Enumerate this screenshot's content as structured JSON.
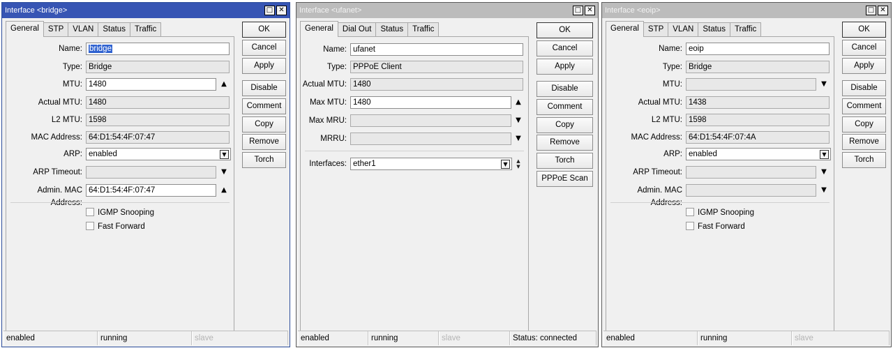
{
  "windows": [
    {
      "title": "Interface <bridge>",
      "tabs": [
        "General",
        "STP",
        "VLAN",
        "Status",
        "Traffic"
      ],
      "fields": {
        "name": {
          "label": "Name:",
          "value": "bridge"
        },
        "type": {
          "label": "Type:",
          "value": "Bridge"
        },
        "mtu": {
          "label": "MTU:",
          "value": "1480"
        },
        "actual_mtu": {
          "label": "Actual MTU:",
          "value": "1480"
        },
        "l2_mtu": {
          "label": "L2 MTU:",
          "value": "1598"
        },
        "mac": {
          "label": "MAC Address:",
          "value": "64:D1:54:4F:07:47"
        },
        "arp": {
          "label": "ARP:",
          "value": "enabled"
        },
        "arp_timeout": {
          "label": "ARP Timeout:",
          "value": ""
        },
        "admin_mac": {
          "label": "Admin. MAC Address:",
          "value": "64:D1:54:4F:07:47"
        }
      },
      "checkboxes": {
        "igmp": "IGMP Snooping",
        "fast_forward": "Fast Forward"
      },
      "buttons": {
        "ok": "OK",
        "cancel": "Cancel",
        "apply": "Apply",
        "disable": "Disable",
        "comment": "Comment",
        "copy": "Copy",
        "remove": "Remove",
        "torch": "Torch"
      },
      "status": {
        "state": "enabled",
        "run": "running",
        "slave": "slave"
      }
    },
    {
      "title": "Interface <ufanet>",
      "tabs": [
        "General",
        "Dial Out",
        "Status",
        "Traffic"
      ],
      "fields": {
        "name": {
          "label": "Name:",
          "value": "ufanet"
        },
        "type": {
          "label": "Type:",
          "value": "PPPoE Client"
        },
        "actual_mtu": {
          "label": "Actual MTU:",
          "value": "1480"
        },
        "max_mtu": {
          "label": "Max MTU:",
          "value": "1480"
        },
        "max_mru": {
          "label": "Max MRU:",
          "value": ""
        },
        "mrru": {
          "label": "MRRU:",
          "value": ""
        },
        "interfaces": {
          "label": "Interfaces:",
          "value": "ether1"
        }
      },
      "buttons": {
        "ok": "OK",
        "cancel": "Cancel",
        "apply": "Apply",
        "disable": "Disable",
        "comment": "Comment",
        "copy": "Copy",
        "remove": "Remove",
        "torch": "Torch",
        "pppoe_scan": "PPPoE Scan"
      },
      "status": {
        "state": "enabled",
        "run": "running",
        "slave": "slave",
        "connection": "Status: connected"
      }
    },
    {
      "title": "Interface <eoip>",
      "tabs": [
        "General",
        "STP",
        "VLAN",
        "Status",
        "Traffic"
      ],
      "fields": {
        "name": {
          "label": "Name:",
          "value": "eoip"
        },
        "type": {
          "label": "Type:",
          "value": "Bridge"
        },
        "mtu": {
          "label": "MTU:",
          "value": ""
        },
        "actual_mtu": {
          "label": "Actual MTU:",
          "value": "1438"
        },
        "l2_mtu": {
          "label": "L2 MTU:",
          "value": "1598"
        },
        "mac": {
          "label": "MAC Address:",
          "value": "64:D1:54:4F:07:4A"
        },
        "arp": {
          "label": "ARP:",
          "value": "enabled"
        },
        "arp_timeout": {
          "label": "ARP Timeout:",
          "value": ""
        },
        "admin_mac": {
          "label": "Admin. MAC Address:",
          "value": ""
        }
      },
      "checkboxes": {
        "igmp": "IGMP Snooping",
        "fast_forward": "Fast Forward"
      },
      "buttons": {
        "ok": "OK",
        "cancel": "Cancel",
        "apply": "Apply",
        "disable": "Disable",
        "comment": "Comment",
        "copy": "Copy",
        "remove": "Remove",
        "torch": "Torch"
      },
      "status": {
        "state": "enabled",
        "run": "running",
        "slave": "slave"
      }
    }
  ],
  "icons": {
    "restore": "restore-icon",
    "close": "close-icon",
    "dropdown": "dropdown-icon",
    "arrow_up": "arrow-up-icon",
    "arrow_down": "arrow-down-icon"
  },
  "colors": {
    "active_title": "#3755b4",
    "inactive_title": "#bcbcbc",
    "selection": "#2f62d0"
  }
}
